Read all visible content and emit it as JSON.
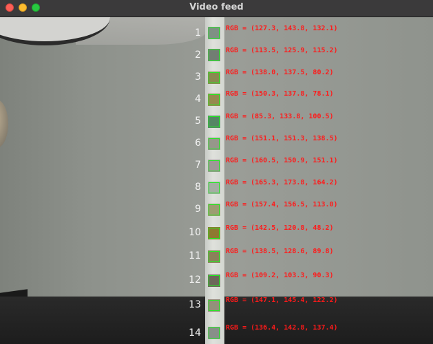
{
  "window": {
    "title": "Video feed"
  },
  "rows": [
    {
      "index": "1",
      "label": "RGB = (127.3, 143.8, 132.1)",
      "color": "#7f9084"
    },
    {
      "index": "2",
      "label": "RGB = (113.5, 125.9, 115.2)",
      "color": "#727e73"
    },
    {
      "index": "3",
      "label": "RGB = (138.0, 137.5, 80.2)",
      "color": "#8a8950"
    },
    {
      "index": "4",
      "label": "RGB = (150.3, 137.8, 78.1)",
      "color": "#968a4e"
    },
    {
      "index": "5",
      "label": "RGB = (85.3, 133.8, 100.5)",
      "color": "#558664"
    },
    {
      "index": "6",
      "label": "RGB = (151.1, 151.3, 138.5)",
      "color": "#97978a"
    },
    {
      "index": "7",
      "label": "RGB = (160.5, 150.9, 151.1)",
      "color": "#a09797"
    },
    {
      "index": "8",
      "label": "RGB = (165.3, 173.8, 164.2)",
      "color": "#a5aea4"
    },
    {
      "index": "9",
      "label": "RGB = (157.4, 156.5, 113.0)",
      "color": "#9d9d71"
    },
    {
      "index": "10",
      "label": "RGB = (142.5, 120.8, 48.2)",
      "color": "#8f7930"
    },
    {
      "index": "11",
      "label": "RGB = (138.5, 128.6, 89.8)",
      "color": "#8b815a"
    },
    {
      "index": "12",
      "label": "RGB = (109.2, 103.3, 90.3)",
      "color": "#6d675a"
    },
    {
      "index": "13",
      "label": "RGB = (147.1, 145.4, 122.2)",
      "color": "#93917a"
    },
    {
      "index": "14",
      "label": "RGB = (136.4, 142.8, 137.4)",
      "color": "#888f89"
    }
  ]
}
